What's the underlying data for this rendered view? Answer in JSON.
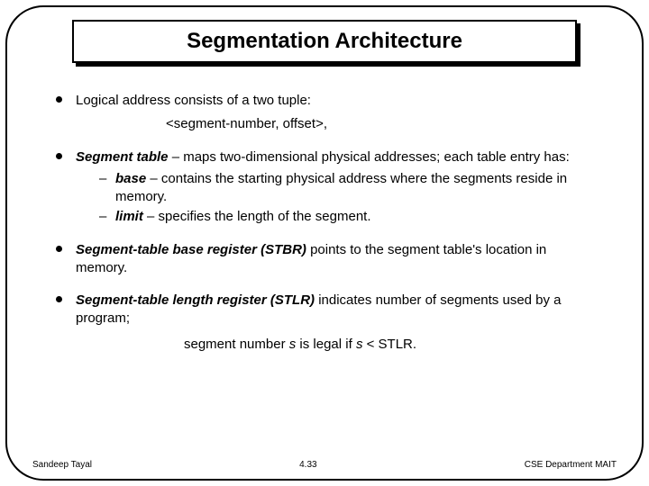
{
  "title": "Segmentation Architecture",
  "bullets": {
    "b1_text": "Logical address consists of a two tuple:",
    "b1_tuple": "<segment-number, offset>,",
    "b2_term": "Segment table",
    "b2_rest": " – maps two-dimensional physical addresses; each table entry has:",
    "b2_sub1_term": "base",
    "b2_sub1_rest": " – contains the starting physical address where the segments reside in memory.",
    "b2_sub2_term": "limit",
    "b2_sub2_rest": " – specifies the length of the segment.",
    "b3_term": "Segment-table base register (STBR)",
    "b3_rest": " points to the segment table's location in memory.",
    "b4_term": "Segment-table length register (STLR)",
    "b4_rest": " indicates number of segments used by a program;",
    "condition_prefix": "segment number ",
    "condition_var1": "s",
    "condition_mid": " is legal if ",
    "condition_var2": "s",
    "condition_suffix": " < STLR."
  },
  "footer": {
    "left": "Sandeep Tayal",
    "center": "4.33",
    "right": "CSE Department MAIT"
  }
}
